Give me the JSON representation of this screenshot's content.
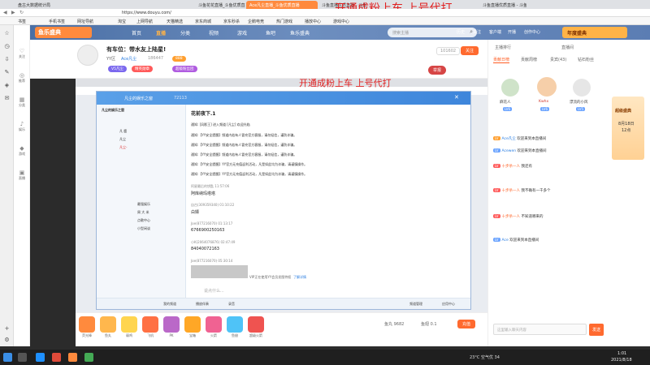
{
  "browser": {
    "tabs": [
      "盘古大数据统计局",
      "斗鱼花花直播_斗鱼优质直播",
      "Ace凡尘直播_斗鱼优质直播",
      "斗鱼直播优质直播 - 斗鱼",
      "斗鱼直播优质直播 - 斗鱼"
    ],
    "active_tab_index": 2,
    "url": "https://www.douyu.com/",
    "bookmarks": [
      "书签",
      "手机书签",
      "网址导航",
      "淘宝",
      "上网导航",
      "天猫精选",
      "京东商城",
      "京东秒杀",
      "企鹅电竞",
      "热门游戏",
      "播放中心",
      "游戏中心"
    ]
  },
  "watermark": "开通成粉上车 上号代打",
  "left_nav": [
    "关注",
    "推荐",
    "分类",
    "娱乐",
    "游戏",
    "直播"
  ],
  "header": {
    "logo": "鱼乐盛典",
    "nav": [
      "首页",
      "直播",
      "分类",
      "视频",
      "游戏",
      "鱼吧",
      "鱼乐盛典"
    ],
    "active_nav": "直播",
    "search_placeholder": "搜索主播",
    "icons": [
      "历史",
      "关注",
      "客户端",
      "开播",
      "创作中心"
    ],
    "event_logo": "年度盛典"
  },
  "room": {
    "title": "有车位：带水友上陆星!",
    "category": "YY区",
    "streamer": "Ace凡尘",
    "followers": "186447",
    "fan_label": "888",
    "tags": [
      "V5凡尘",
      "精英勋章",
      "超级粉丝团"
    ],
    "room_id": "101602",
    "follow_label": "关注",
    "report_label": "举报"
  },
  "yy": {
    "channel": "凡尘的娱乐之窗",
    "channel_id": "72113",
    "topic": "花前夜下.1",
    "list_header": "凡尘的娱乐之窗",
    "entries": [
      "凡 鹿",
      "凡尘",
      "凡尘- ",
      "最强娱乐",
      "周 大 米",
      "点歌中心",
      "小型闲谈"
    ],
    "notices": [
      "通知: [风影王] 进入频道 [凡尘] 欢迎光临",
      "通知:【YY安全提醒】频道内若有人冒充官方客服，请勿轻信，谨防诈骗。",
      "通知:【YY安全提醒】频道内若有人冒充官方客服，请勿轻信，谨防诈骗。",
      "通知:【YY安全提醒】频道内若有人冒充官方客服，请勿轻信，谨防诈骗。",
      "通知:【YY安全提醒】YY官方无充值返利活动，凡是如此均为诈骗，请谨慎操作。",
      "通知:【YY安全提醒】YY官方无充值返利活动，凡是如此均为诈骗，请谨慎操作。"
    ],
    "messages": [
      {
        "name": "阿星最后的钥匙 11:57:06",
        "text": "阿库纳玛塔塔"
      },
      {
        "name": "自古(309359340) 01:10:22",
        "text": "白嫖"
      },
      {
        "name": "Joe(877216070) 01:13:17",
        "text": "6766900250163"
      },
      {
        "name": "小K(2064076876) 02:47:49",
        "text": "84040072163"
      },
      {
        "name": "Joe(877216070) 05:30:14",
        "text": "[图片]"
      }
    ],
    "vip_notice": "VIP正在使用YY会员发图特权",
    "vip_link": "了解详情",
    "input_placeholder": "说点什么...",
    "toolbar": [
      "我的频道",
      "播放伴奏",
      "录音"
    ],
    "right_toolbar": [
      "频道管理",
      "应用中心"
    ]
  },
  "gifts": [
    {
      "label": "荧光棒",
      "color": "#ff8a3d"
    },
    {
      "label": "鱼丸",
      "color": "#ffb74d"
    },
    {
      "label": "弱鸡",
      "color": "#ffd54f"
    },
    {
      "label": "飞机",
      "color": "#ff7043"
    },
    {
      "label": "PK",
      "color": "#ba68c8"
    },
    {
      "label": "宝箱",
      "color": "#ffa726"
    },
    {
      "label": "火箭",
      "color": "#f06292"
    },
    {
      "label": "鱼翅",
      "color": "#4fc3f7"
    },
    {
      "label": "超级火箭",
      "color": "#ef5350"
    }
  ],
  "gift_count": "鱼丸 9682",
  "fish_count": "鱼翅 0.1",
  "recharge": "充值",
  "right_panel": {
    "tabs": [
      "主播排行",
      "直播间",
      "贡献日榜",
      "贡献周榜",
      "贵宾(43)",
      "钻石粉丝"
    ],
    "top_fans": [
      {
        "name": "麻花人",
        "lv": "LV6"
      },
      {
        "name": "Kwhx",
        "lv": "LV6"
      },
      {
        "name": "漂流的小风",
        "lv": "LV5"
      }
    ],
    "event_text": "超级盛典",
    "event_date": "8月18日",
    "event_time": "12点",
    "danmaku": [
      {
        "user": "Ace凡尘",
        "text": "欢迎来到本直播间"
      },
      {
        "user": "Acewen",
        "text": "欢迎来到本直播间"
      },
      {
        "user": "十步杀一人",
        "text": "我还有"
      },
      {
        "user": "十步杀一人",
        "text": "我不确有一千多个"
      },
      {
        "user": "十步杀一人",
        "text": "不知道哪来的"
      },
      {
        "user": "Ace",
        "text": "欢迎来到本直播间"
      }
    ],
    "input_placeholder": "这里输入聊天内容",
    "send_label": "发送"
  },
  "taskbar": {
    "weather": "23°C 空气优 34",
    "time": "1:01",
    "date": "2021/8/18"
  }
}
